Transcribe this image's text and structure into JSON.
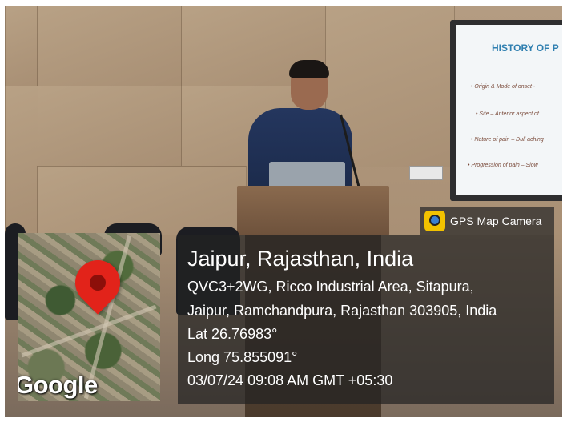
{
  "slide": {
    "title": "HISTORY OF P",
    "lines": [
      "• Origin & Mode of onset -",
      "• Site – Anterior aspect of",
      "• Nature of pain – Dull aching",
      "• Progression of pain – Slow"
    ]
  },
  "map": {
    "watermark": "Google",
    "pin_color": "#e2231a"
  },
  "gps_badge": {
    "label": "GPS Map Camera",
    "icon": "gps-camera-app-icon"
  },
  "location": {
    "title": "Jaipur, Rajasthan, India",
    "address_line1": "QVC3+2WG, Ricco Industrial Area, Sitapura,",
    "address_line2": "Jaipur, Ramchandpura, Rajasthan 303905, India",
    "latitude": "Lat 26.76983°",
    "longitude": "Long 75.855091°",
    "timestamp": "03/07/24 09:08 AM GMT +05:30"
  }
}
